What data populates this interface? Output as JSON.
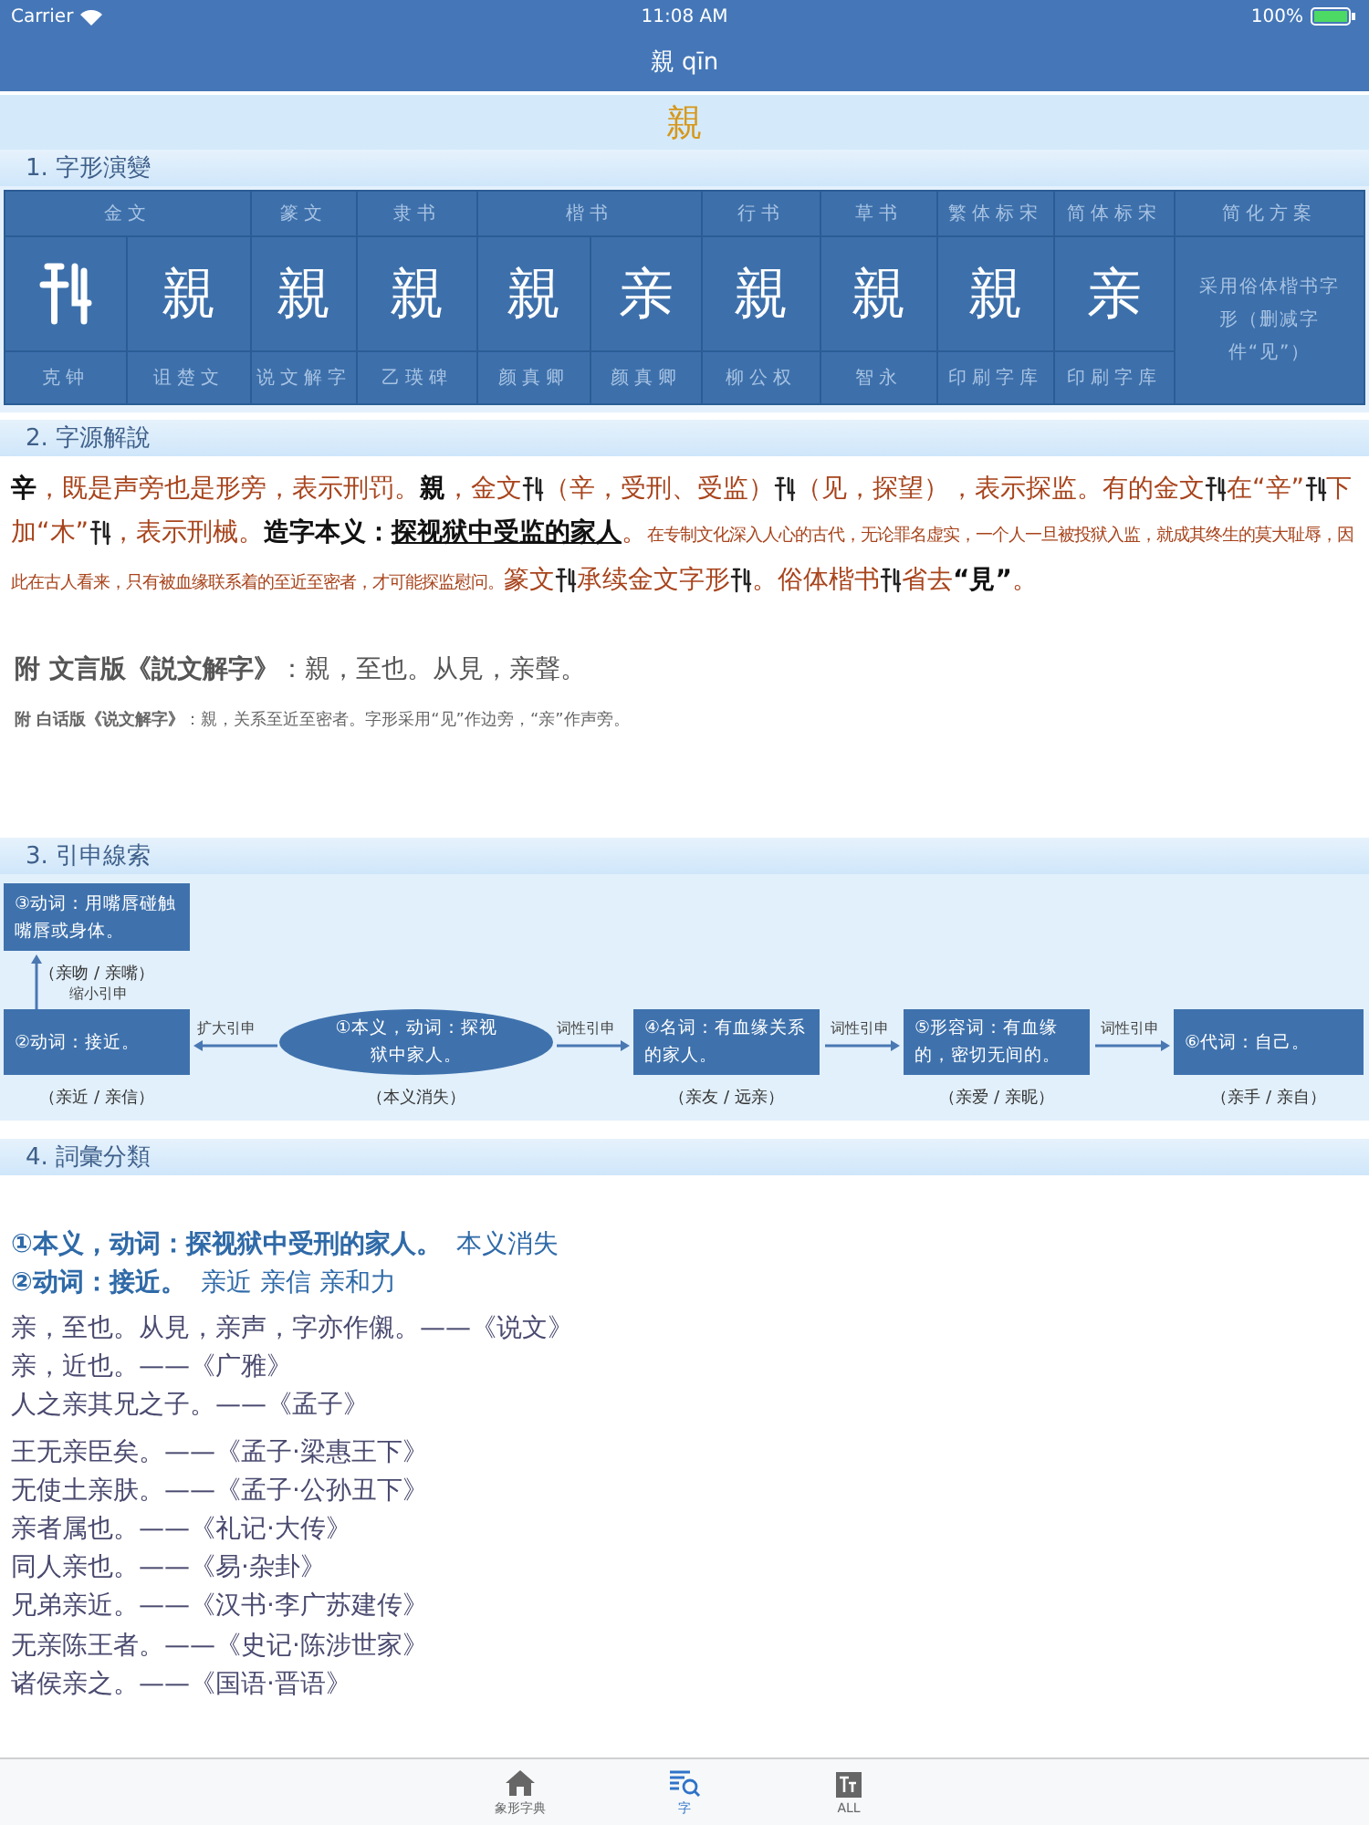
{
  "status_bar": {
    "carrier": "Carrier",
    "time": "11:08 AM",
    "battery": "100%"
  },
  "nav": {
    "title": "親 qīn"
  },
  "headword": "親",
  "sections": [
    {
      "title": "1. 字形演變"
    },
    {
      "title": "2. 字源解說"
    },
    {
      "title": "3. 引申線索"
    },
    {
      "title": "4. 詞彙分類"
    }
  ],
  "evolution": {
    "groups": [
      {
        "label": "金文",
        "columns": [
          {
            "kind": "drawing",
            "source": "克钟"
          },
          {
            "kind": "char",
            "char": "親",
            "source": "诅楚文"
          }
        ]
      },
      {
        "label": "篆文",
        "columns": [
          {
            "kind": "char",
            "char": "親",
            "source": "说文解字"
          }
        ]
      },
      {
        "label": "隶书",
        "columns": [
          {
            "kind": "char",
            "char": "親",
            "source": "乙瑛碑"
          }
        ]
      },
      {
        "label": "楷书",
        "columns": [
          {
            "kind": "char",
            "char": "親",
            "source": "颜真卿"
          },
          {
            "kind": "char",
            "char": "亲",
            "source": "颜真卿"
          }
        ]
      },
      {
        "label": "行书",
        "columns": [
          {
            "kind": "char",
            "char": "親",
            "source": "柳公权"
          }
        ]
      },
      {
        "label": "草书",
        "columns": [
          {
            "kind": "char",
            "char": "親",
            "source": "智永"
          }
        ]
      },
      {
        "label": "繁体标宋",
        "columns": [
          {
            "kind": "char",
            "char": "親",
            "source": "印刷字库"
          }
        ]
      },
      {
        "label": "简体标宋",
        "columns": [
          {
            "kind": "char",
            "char": "亲",
            "source": "印刷字库"
          }
        ]
      }
    ],
    "scheme": {
      "header": "简化方案",
      "note": "采用俗体楷书字形（删减字件“见”）"
    }
  },
  "origin": {
    "segments": [
      {
        "kind": "bold",
        "text": "辛"
      },
      {
        "kind": "plain",
        "text": "，既是声旁也是形旁，表示刑罚。"
      },
      {
        "kind": "bold",
        "text": "親"
      },
      {
        "kind": "plain",
        "text": "，金文"
      },
      {
        "kind": "glyph"
      },
      {
        "kind": "plain",
        "text": "（辛，受刑、受监）"
      },
      {
        "kind": "glyph"
      },
      {
        "kind": "plain",
        "text": "（见，探望），表示探监。有的金文"
      },
      {
        "kind": "glyph"
      },
      {
        "kind": "plain",
        "text": "在“辛”"
      },
      {
        "kind": "glyph"
      },
      {
        "kind": "plain",
        "text": "下加“木”"
      },
      {
        "kind": "glyph"
      },
      {
        "kind": "plain",
        "text": "，表示刑械。"
      },
      {
        "kind": "bold",
        "text": "造字本义："
      },
      {
        "kind": "underline",
        "text": "探视狱中受监的家人"
      },
      {
        "kind": "plain",
        "text": "。"
      },
      {
        "kind": "small",
        "text": "在专制文化深入人心的古代，无论罪名虚实，一个人一旦被投狱入监，就成其终生的莫大耻辱，因此在古人看来，只有被血缘联系着的至近至密者，才可能探监慰问。"
      },
      {
        "kind": "plain",
        "text": "篆文"
      },
      {
        "kind": "glyph"
      },
      {
        "kind": "plain",
        "text": "承续金文字形"
      },
      {
        "kind": "glyph"
      },
      {
        "kind": "plain",
        "text": "。俗体楷书"
      },
      {
        "kind": "glyph"
      },
      {
        "kind": "plain",
        "text": "省去"
      },
      {
        "kind": "bold",
        "text": "“見”"
      },
      {
        "kind": "plain",
        "text": "。"
      }
    ],
    "classical": "**附 文言版《説文解字》**：親，至也。从見，亲聲。",
    "vernacular": "**附 白话版《说文解字》**：親，关系至近至密者。字形采用“见”作边旁，“亲”作声旁。"
  },
  "diagram": {
    "nodes": [
      {
        "kind": "box",
        "text": "③动词：用嘴唇碰触嘴唇或身体。",
        "caption": "（亲吻 / 亲嘴）"
      },
      {
        "kind": "box",
        "text": "②动词：接近。",
        "caption": "（亲近 / 亲信）"
      },
      {
        "kind": "ellipse",
        "text": "①本义，动词：探视狱中家人。",
        "caption": "（本义消失）"
      },
      {
        "kind": "box",
        "text": "④名词：有血缘关系的家人。",
        "caption": "（亲友 / 远亲）"
      },
      {
        "kind": "box",
        "text": "⑤形容词：有血缘的，密切无间的。",
        "caption": "（亲爱 / 亲昵）"
      },
      {
        "kind": "box",
        "text": "⑥代词：自己。",
        "caption": "（亲手 / 亲自）"
      }
    ],
    "arrows": [
      {
        "label": "缩小引申"
      },
      {
        "label": "扩大引申"
      },
      {
        "label": "词性引申"
      },
      {
        "label": "词性引申"
      },
      {
        "label": "词性引申"
      }
    ]
  },
  "vocabulary": {
    "senses": [
      {
        "title": "①本义，动词：探视狱中受刑的家人。",
        "words": "本义消失"
      },
      {
        "title": "②动词：接近。",
        "words": "亲近 亲信 亲和力"
      }
    ],
    "quote_groups": [
      {
        "lines": [
          "亲，至也。从見，亲声，字亦作儭。——《说文》",
          "亲，近也。——《广雅》",
          "人之亲其兄之子。——《孟子》"
        ]
      },
      {
        "lines": [
          "王无亲臣矣。——《孟子·梁惠王下》",
          "无使土亲肤。——《孟子·公孙丑下》",
          "亲者属也。——《礼记·大传》",
          "同人亲也。——《易·杂卦》",
          "兄弟亲近。——《汉书·李广苏建传》",
          "无亲陈王者。——《史记·陈涉世家》",
          "诸侯亲之。——《国语·晋语》"
        ]
      }
    ]
  },
  "tab_bar": [
    {
      "kind": "home",
      "label": "象形字典",
      "selected": false
    },
    {
      "kind": "search",
      "label": "字",
      "selected": true
    },
    {
      "kind": "text",
      "label": "ALL",
      "selected": false
    }
  ]
}
